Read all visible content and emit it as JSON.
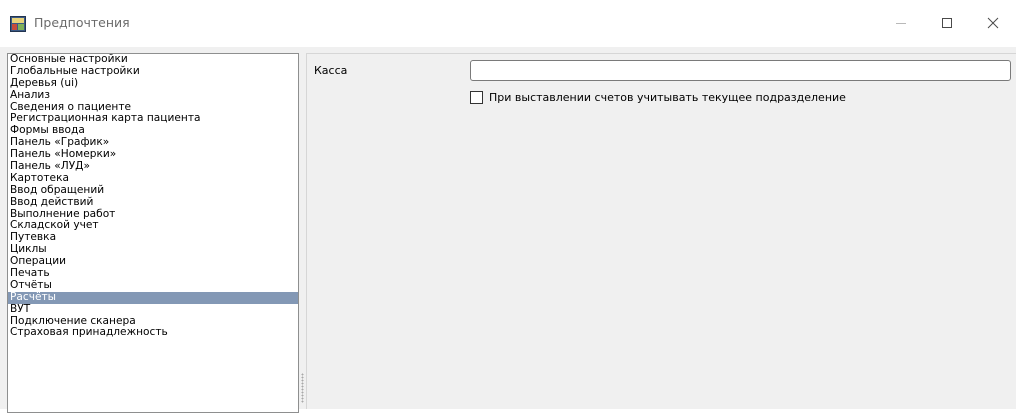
{
  "window": {
    "title": "Предпочтения"
  },
  "sidebar": {
    "items": [
      {
        "label": "Основные настройки"
      },
      {
        "label": "Глобальные настройки"
      },
      {
        "label": "Деревья (ui)"
      },
      {
        "label": "Анализ"
      },
      {
        "label": "Сведения о пациенте"
      },
      {
        "label": "Регистрационная карта пациента"
      },
      {
        "label": "Формы ввода"
      },
      {
        "label": "Панель «График»"
      },
      {
        "label": "Панель «Номерки»"
      },
      {
        "label": "Панель «ЛУД»"
      },
      {
        "label": "Картотека"
      },
      {
        "label": "Ввод обращений"
      },
      {
        "label": "Ввод действий"
      },
      {
        "label": "Выполнение работ"
      },
      {
        "label": "Складской учет"
      },
      {
        "label": "Путевка"
      },
      {
        "label": "Циклы"
      },
      {
        "label": "Операции"
      },
      {
        "label": "Печать"
      },
      {
        "label": "Отчёты"
      },
      {
        "label": "Расчёты"
      },
      {
        "label": "ВУТ"
      },
      {
        "label": "Подключение сканера"
      },
      {
        "label": "Страховая принадлежность"
      }
    ],
    "selected_index": 20,
    "selected_label": "Расчёты"
  },
  "settings": {
    "cash_label": "Касса",
    "cash_value": "",
    "checkbox_label": "При выставлении счетов учитывать текущее подразделение",
    "checkbox_checked": false
  },
  "colors": {
    "selection": "#8398b5",
    "dialog_bg": "#f0f0f0"
  }
}
